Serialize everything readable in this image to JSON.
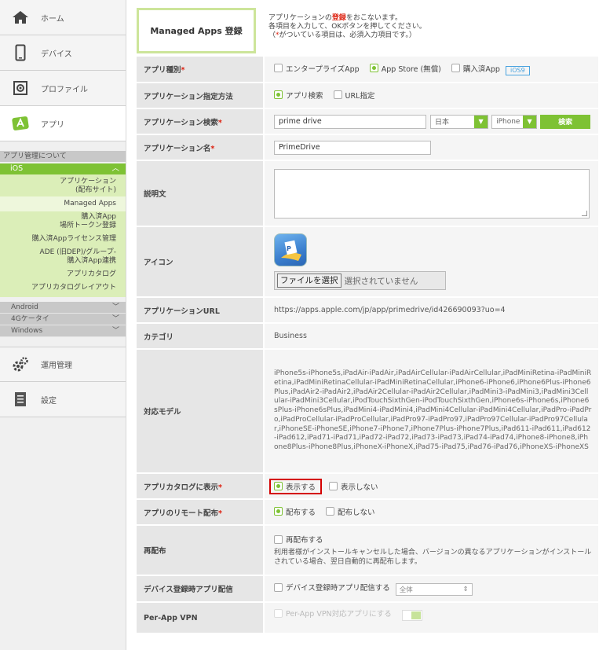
{
  "sidebar": {
    "nav": [
      {
        "label": "ホーム",
        "icon": "home-icon"
      },
      {
        "label": "デバイス",
        "icon": "device-icon"
      },
      {
        "label": "プロファイル",
        "icon": "profile-icon"
      },
      {
        "label": "アプリ",
        "icon": "app-icon"
      }
    ],
    "about_label": "アプリ管理について",
    "ios_label": "iOS",
    "ios_sub": [
      "アプリケーション\n(配布サイト)",
      "Managed Apps",
      "購入済App\n場所トークン登録",
      "購入済Appライセンス管理",
      "ADE (旧DEP)/グループ-\n購入済App連携",
      "アプリカタログ",
      "アプリカタログレイアウト"
    ],
    "os_rows": [
      "Android",
      "4Gケータイ",
      "Windows"
    ],
    "bottom_nav": [
      {
        "label": "運用管理",
        "icon": "gears-icon"
      },
      {
        "label": "設定",
        "icon": "settings-icon"
      }
    ]
  },
  "header": {
    "title": "Managed Apps 登録",
    "desc_line1_a": "アプリケーションの",
    "desc_line1_b": "登録",
    "desc_line1_c": "をおこないます。",
    "desc_line2": "各項目を入力して、OKボタンを押してください。",
    "desc_line3_a": "（",
    "desc_line3_b": "*",
    "desc_line3_c": "がついている項目は、必須入力項目です。）"
  },
  "form": {
    "app_type": {
      "label": "アプリ種別",
      "options": [
        "エンタープライズApp",
        "App Store (無償)",
        "購入済App"
      ],
      "badge": "iOS9"
    },
    "spec_method": {
      "label": "アプリケーション指定方法",
      "options": [
        "アプリ検索",
        "URL指定"
      ]
    },
    "search": {
      "label": "アプリケーション検索",
      "query": "prime drive",
      "country": "日本",
      "device": "iPhone",
      "button": "検索"
    },
    "app_name": {
      "label": "アプリケーション名",
      "value": "PrimeDrive"
    },
    "description": {
      "label": "説明文"
    },
    "icon": {
      "label": "アイコン",
      "file_button": "ファイルを選択",
      "file_status": "選択されていません"
    },
    "url": {
      "label": "アプリケーションURL",
      "value": "https://apps.apple.com/jp/app/primedrive/id426690093?uo=4"
    },
    "category": {
      "label": "カテゴリ",
      "value": "Business"
    },
    "models": {
      "label": "対応モデル",
      "value": "iPhone5s-iPhone5s,iPadAir-iPadAir,iPadAirCellular-iPadAirCellular,iPadMiniRetina-iPadMiniRetina,iPadMiniRetinaCellular-iPadMiniRetinaCellular,iPhone6-iPhone6,iPhone6Plus-iPhone6Plus,iPadAir2-iPadAir2,iPadAir2Cellular-iPadAir2Cellular,iPadMini3-iPadMini3,iPadMini3Cellular-iPadMini3Cellular,iPodTouchSixthGen-iPodTouchSixthGen,iPhone6s-iPhone6s,iPhone6sPlus-iPhone6sPlus,iPadMini4-iPadMini4,iPadMini4Cellular-iPadMini4Cellular,iPadPro-iPadPro,iPadProCellular-iPadProCellular,iPadPro97-iPadPro97,iPadPro97Cellular-iPadPro97Cellular,iPhoneSE-iPhoneSE,iPhone7-iPhone7,iPhone7Plus-iPhone7Plus,iPad611-iPad611,iPad612-iPad612,iPad71-iPad71,iPad72-iPad72,iPad73-iPad73,iPad74-iPad74,iPhone8-iPhone8,iPhone8Plus-iPhone8Plus,iPhoneX-iPhoneX,iPad75-iPad75,iPad76-iPad76,iPhoneXS-iPhoneXS"
    },
    "catalog": {
      "label": "アプリカタログに表示",
      "options": [
        "表示する",
        "表示しない"
      ]
    },
    "remote": {
      "label": "アプリのリモート配布",
      "options": [
        "配布する",
        "配布しない"
      ]
    },
    "redist": {
      "label": "再配布",
      "option": "再配布する",
      "note": "利用者様がインストールキャンセルした場合、バージョンの異なるアプリケーションがインストールされている場合、翌日自動的に再配布します。"
    },
    "enroll": {
      "label": "デバイス登録時アプリ配信",
      "option": "デバイス登録時アプリ配信する",
      "select": "全体"
    },
    "vpn": {
      "label": "Per-App VPN",
      "option": "Per-App VPN対応アプリにする"
    }
  },
  "colors": {
    "accent": "#7ec234",
    "required": "#dd2211",
    "highlight": "#d40000"
  }
}
